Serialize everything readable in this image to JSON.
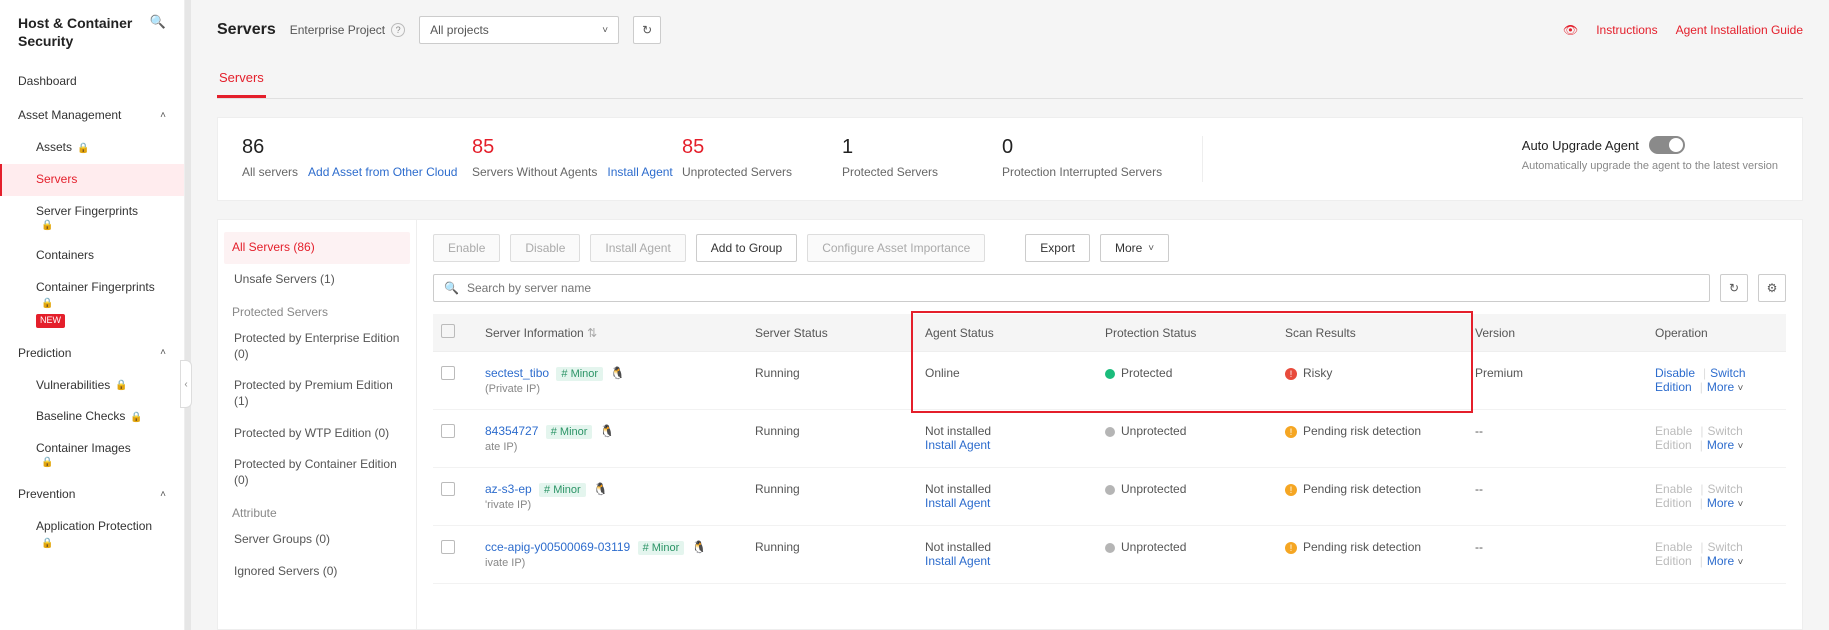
{
  "sidebar": {
    "title": "Host & Container Security",
    "dashboard": "Dashboard",
    "asset_mgmt": "Asset Management",
    "assets": "Assets",
    "servers": "Servers",
    "server_fingerprints": "Server Fingerprints",
    "containers": "Containers",
    "container_fingerprints": "Container Fingerprints",
    "new_badge": "NEW",
    "prediction": "Prediction",
    "vulnerabilities": "Vulnerabilities",
    "baseline": "Baseline Checks",
    "container_images": "Container Images",
    "prevention": "Prevention",
    "app_protection": "Application Protection"
  },
  "header": {
    "title": "Servers",
    "ep_label": "Enterprise Project",
    "ep_value": "All projects",
    "instructions": "Instructions",
    "install_guide": "Agent Installation Guide"
  },
  "tabs": {
    "servers": "Servers"
  },
  "stats": {
    "all_servers_num": "86",
    "all_servers_label": "All servers",
    "add_asset": "Add Asset from Other Cloud",
    "without_agents_num": "85",
    "without_agents_label": "Servers Without Agents",
    "install_agent": "Install Agent",
    "unprotected_num": "85",
    "unprotected_label": "Unprotected Servers",
    "protected_num": "1",
    "protected_label": "Protected Servers",
    "interrupted_num": "0",
    "interrupted_label": "Protection Interrupted Servers",
    "auto_upgrade_title": "Auto Upgrade Agent",
    "auto_upgrade_sub": "Automatically upgrade the agent to the latest version"
  },
  "left_panel": {
    "all_servers": "All Servers (86)",
    "unsafe_servers": "Unsafe Servers (1)",
    "protected_head": "Protected Servers",
    "by_enterprise": "Protected by Enterprise Edition (0)",
    "by_premium": "Protected by Premium Edition (1)",
    "by_wtp": "Protected by WTP Edition (0)",
    "by_container": "Protected by Container Edition (0)",
    "attribute_head": "Attribute",
    "server_groups": "Server Groups (0)",
    "ignored_servers": "Ignored Servers (0)"
  },
  "toolbar": {
    "enable": "Enable",
    "disable": "Disable",
    "install_agent": "Install Agent",
    "add_to_group": "Add to Group",
    "configure_importance": "Configure Asset Importance",
    "export": "Export",
    "more": "More",
    "search_placeholder": "Search by server name"
  },
  "columns": {
    "server_info": "Server Information",
    "server_status": "Server Status",
    "agent_status": "Agent Status",
    "protection_status": "Protection Status",
    "scan_results": "Scan Results",
    "version": "Version",
    "operation": "Operation"
  },
  "ops": {
    "disable": "Disable",
    "enable": "Enable",
    "switch_edition": "Switch Edition",
    "more": "More",
    "install_agent": "Install Agent",
    "not_installed": "Not installed"
  },
  "rows": [
    {
      "name": "sectest_tibo",
      "tag": "# Minor",
      "ip": "(Private IP)",
      "server_status": "Running",
      "agent_status": "Online",
      "agent_sub": "",
      "protection": "Protected",
      "protection_color": "green",
      "scan": "Risky",
      "scan_color": "red",
      "version": "Premium",
      "op_primary": "Disable",
      "op_primary_enabled": true
    },
    {
      "name": "84354727",
      "tag": "# Minor",
      "ip": "ate IP)",
      "server_status": "Running",
      "agent_status": "Not installed",
      "agent_sub": "Install Agent",
      "protection": "Unprotected",
      "protection_color": "gray",
      "scan": "Pending risk detection",
      "scan_color": "yellow",
      "version": "--",
      "op_primary": "Enable",
      "op_primary_enabled": false
    },
    {
      "name": "az-s3-ep",
      "tag": "# Minor",
      "ip": "'rivate IP)",
      "server_status": "Running",
      "agent_status": "Not installed",
      "agent_sub": "Install Agent",
      "protection": "Unprotected",
      "protection_color": "gray",
      "scan": "Pending risk detection",
      "scan_color": "yellow",
      "version": "--",
      "op_primary": "Enable",
      "op_primary_enabled": false
    },
    {
      "name": "cce-apig-y00500069-03119",
      "tag": "# Minor",
      "ip": "ivate IP)",
      "server_status": "Running",
      "agent_status": "Not installed",
      "agent_sub": "Install Agent",
      "protection": "Unprotected",
      "protection_color": "gray",
      "scan": "Pending risk detection",
      "scan_color": "yellow",
      "version": "--",
      "op_primary": "Enable",
      "op_primary_enabled": false
    }
  ]
}
